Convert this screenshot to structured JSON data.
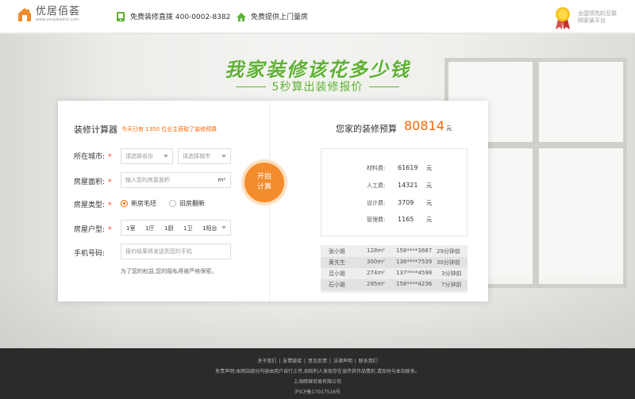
{
  "header": {
    "logo_name": "优居佰荟",
    "logo_url": "www.youjubaihui.com",
    "hotline": "免费装修直拨 400-0002-8382",
    "service": "免费提供上门量房",
    "platform": "全国领先的互联网家装平台"
  },
  "hero": {
    "title": "我家装修该花多少钱",
    "subtitle": "5秒算出装修报价"
  },
  "calculator": {
    "title": "装修计算器",
    "count_prefix": "今天已有",
    "count_num": "1350",
    "count_suffix": "位业主获取了装修预算",
    "city_label": "所在城市:",
    "province_placeholder": "请选择省份",
    "city_placeholder": "请选择城市",
    "area_label": "房屋面积:",
    "area_placeholder": "输入您的房屋面积",
    "area_unit": "m²",
    "type_label": "房屋类型:",
    "type_options": [
      "新房毛坯",
      "旧房翻新"
    ],
    "layout_label": "房屋户型:",
    "layout_values": [
      "1室",
      "1厅",
      "1厨",
      "1卫",
      "1阳台"
    ],
    "phone_label": "手机号码:",
    "phone_placeholder": "报价结果将发送到您的手机",
    "privacy": "为了您的权益,您的隐私将被严格保密。",
    "required": "*",
    "start_line1": "开始",
    "start_line2": "计算"
  },
  "result": {
    "budget_label": "您家的装修预算",
    "budget_value": "80814",
    "budget_unit": "元",
    "costs": [
      {
        "name": "材料费:",
        "value": "61619",
        "unit": "元"
      },
      {
        "name": "人工费:",
        "value": "14321",
        "unit": "元"
      },
      {
        "name": "设计费:",
        "value": "3709",
        "unit": "元"
      },
      {
        "name": "管理费:",
        "value": "1165",
        "unit": "元"
      }
    ],
    "records": [
      {
        "name": "张小姐",
        "area": "128m²",
        "phone": "158****3687",
        "time": "29分钟前"
      },
      {
        "name": "黄先生",
        "area": "300m²",
        "phone": "136****7539",
        "time": "30分钟前"
      },
      {
        "name": "吕小姐",
        "area": "274m²",
        "phone": "137****4598",
        "time": "3分钟前"
      },
      {
        "name": "石小姐",
        "area": "295m²",
        "phone": "158****4236",
        "time": "7分钟前"
      }
    ]
  },
  "footer": {
    "links": [
      "关于我们",
      "友情链接",
      "意见反馈",
      "法律声明",
      "联系我们"
    ],
    "disclaimer": "免责声明:本网站部分内容由用户自行上传,如权利人发现存在误传其作品情形,请及时与本站联系。",
    "company": "上海暗禅贸易有限公司",
    "icp": "沪ICP备17017516号"
  },
  "colors": {
    "brand_orange": "#f28c2c",
    "title_green": "#5fb233",
    "budget_orange": "#ff6600"
  }
}
